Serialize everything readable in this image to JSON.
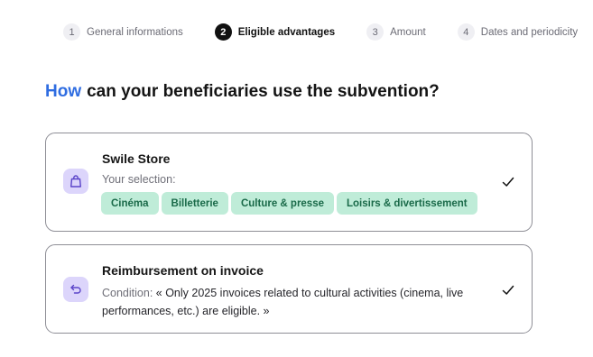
{
  "stepper": {
    "steps": [
      {
        "number": "1",
        "label": "General informations",
        "active": false
      },
      {
        "number": "2",
        "label": "Eligible advantages",
        "active": true
      },
      {
        "number": "3",
        "label": "Amount",
        "active": false
      },
      {
        "number": "4",
        "label": "Dates and periodicity",
        "active": false
      }
    ]
  },
  "heading": {
    "accent": "How",
    "rest": "can your beneficiaries use the subvention?"
  },
  "cards": [
    {
      "title": "Swile Store",
      "icon": "shopping-bag-icon",
      "subtitle": "Your selection:",
      "tags": [
        "Cinéma",
        "Billetterie",
        "Culture & presse",
        "Loisirs & divertissement"
      ],
      "selected": true
    },
    {
      "title": "Reimbursement on invoice",
      "icon": "return-arrow-icon",
      "condition_label": "Condition:",
      "condition_text": "« Only 2025 invoices related to cultural activities (cinema, live performances, etc.) are eligible. »",
      "selected": true
    }
  ],
  "colors": {
    "accent": "#2f6de1",
    "tag_bg": "#bfecd8",
    "tag_text": "#1a6a49",
    "icon_bg": "#dcd5fb",
    "icon_stroke": "#5b45c9"
  }
}
